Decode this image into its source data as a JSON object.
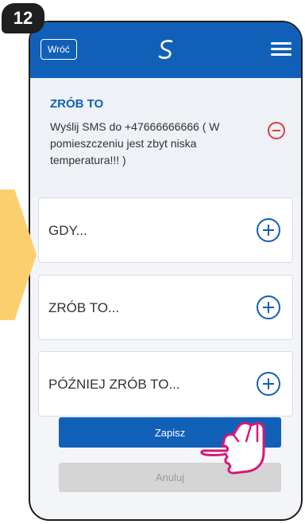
{
  "step": {
    "number": "12"
  },
  "header": {
    "back_label": "Wróć"
  },
  "action": {
    "title": "ZRÓB TO",
    "text": "Wyślij SMS do +47666666666 ( W pomieszczeniu jest zbyt niska temperatura!!! )"
  },
  "sections": [
    {
      "label": "GDY..."
    },
    {
      "label": "ZRÓB TO..."
    },
    {
      "label": "PÓŹNIEJ ZRÓB TO..."
    }
  ],
  "buttons": {
    "save_label": "Zapisz",
    "cancel_label": "Anuluj"
  },
  "colors": {
    "primary": "#1160b8",
    "danger": "#e23b3b",
    "highlight_arrow": "#fbcf6e",
    "pointer_hand": "#d6197a"
  },
  "icons": {
    "back": "back-button",
    "logo": "brand-swirl-icon",
    "menu": "hamburger-menu-icon",
    "remove": "minus-circle-icon",
    "add": "plus-circle-icon",
    "pointer": "pointing-hand-icon"
  }
}
